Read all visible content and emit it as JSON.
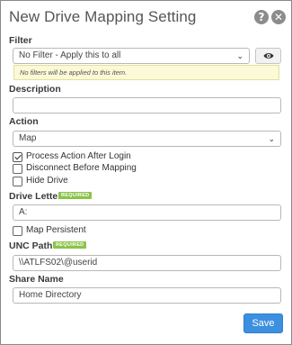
{
  "dialog": {
    "title": "New Drive Mapping Setting",
    "help_icon": "question-circle-icon",
    "close_icon": "close-circle-icon"
  },
  "filter": {
    "label": "Filter",
    "selected": "No Filter - Apply this to all",
    "preview_icon": "eye-icon",
    "note": "No filters will be applied to this item."
  },
  "description": {
    "label": "Description",
    "value": ""
  },
  "action": {
    "label": "Action",
    "selected": "Map",
    "options": [
      {
        "label": "Process Action After Login",
        "checked": true
      },
      {
        "label": "Disconnect Before Mapping",
        "checked": false
      },
      {
        "label": "Hide Drive",
        "checked": false
      }
    ]
  },
  "drive_letter": {
    "label": "Drive Letter",
    "required_badge": "REQUIRED",
    "value": "A:",
    "map_persistent_label": "Map Persistent",
    "map_persistent_checked": false
  },
  "unc_path": {
    "label": "UNC Path",
    "required_badge": "REQUIRED",
    "value": "\\\\ATLFS02\\@userid"
  },
  "share_name": {
    "label": "Share Name",
    "value": "Home Directory"
  },
  "footer": {
    "save_label": "Save",
    "save_color": "#3d8fe0"
  }
}
